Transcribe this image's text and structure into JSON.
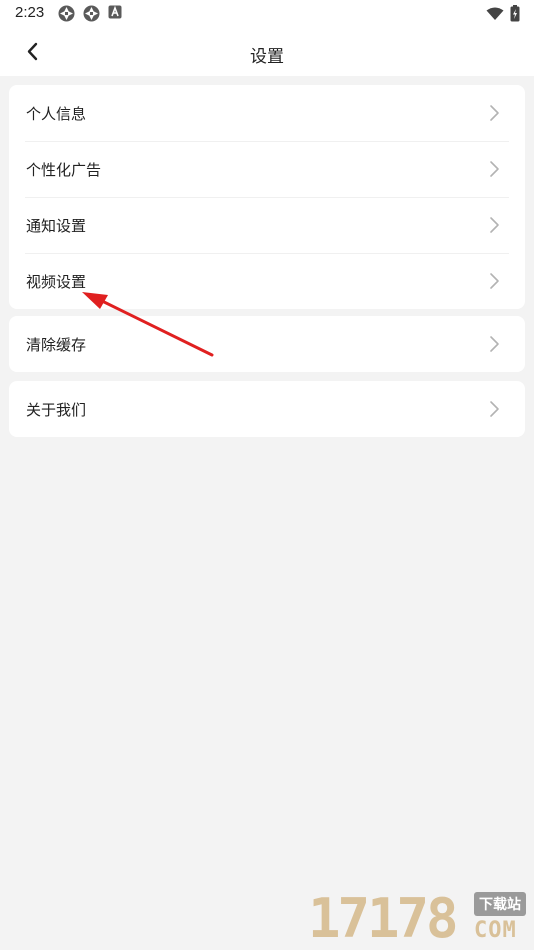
{
  "status_bar": {
    "time": "2:23",
    "left_icons": [
      "aperture-icon",
      "aperture-icon",
      "a-notification-icon"
    ],
    "right_icons": [
      "wifi-icon",
      "battery-charging-icon"
    ]
  },
  "header": {
    "title": "设置",
    "back_icon": "chevron-left-icon"
  },
  "groups": [
    {
      "items": [
        {
          "label": "个人信息"
        },
        {
          "label": "个性化广告"
        },
        {
          "label": "通知设置"
        },
        {
          "label": "视频设置"
        }
      ]
    },
    {
      "items": [
        {
          "label": "清除缓存"
        }
      ]
    },
    {
      "items": [
        {
          "label": "关于我们"
        }
      ]
    }
  ],
  "annotation": {
    "arrow_color": "#e02020"
  },
  "watermark": {
    "digits": "17178",
    "badge": "下载站",
    "suffix": "COM"
  },
  "colors": {
    "background": "#f3f3f3",
    "card": "#ffffff",
    "text": "#222222",
    "chevron": "#b3b3b3"
  }
}
